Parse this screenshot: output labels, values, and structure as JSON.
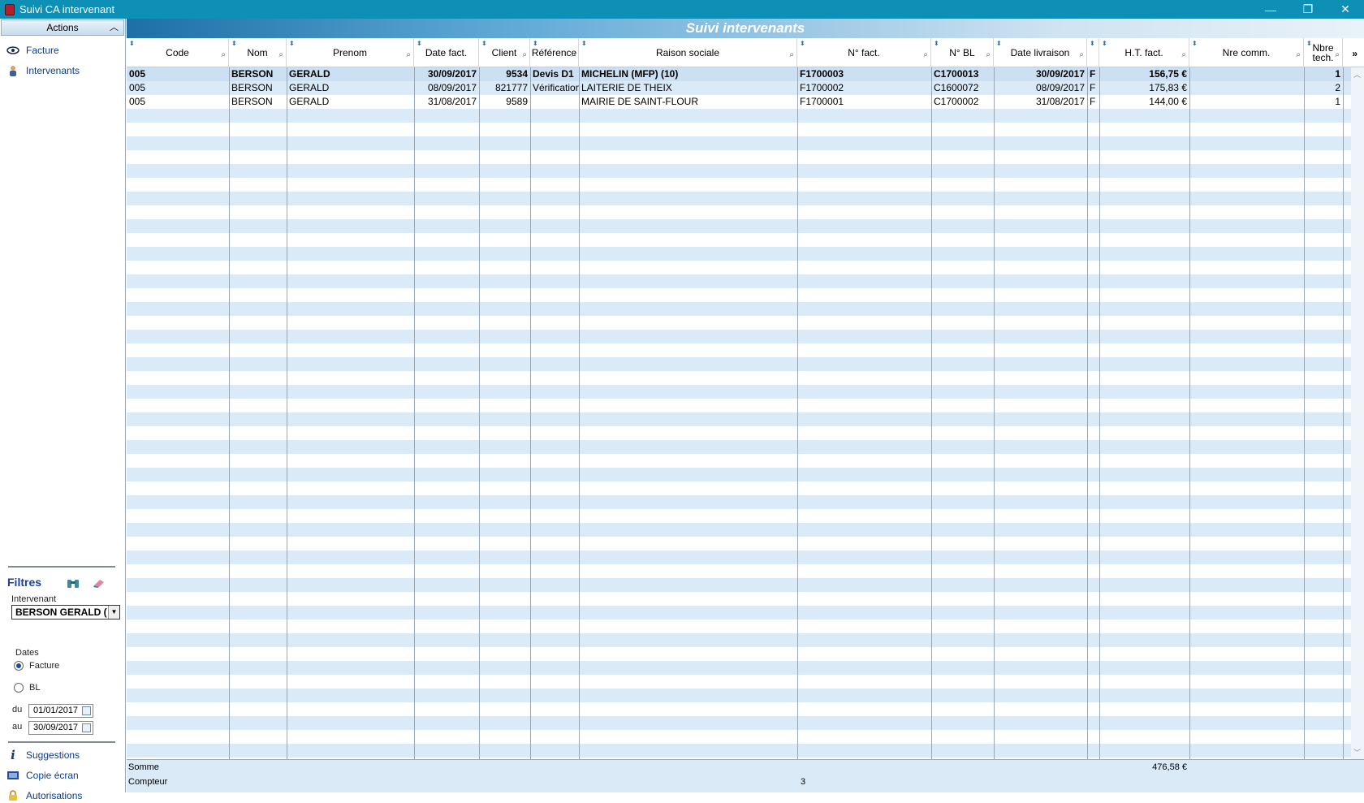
{
  "window": {
    "title": "Suivi CA intervenant",
    "controls": [
      "—",
      "❐",
      "✕"
    ]
  },
  "sidebar": {
    "actions_label": "Actions",
    "items": [
      {
        "label": "Facture",
        "icon": "eye-icon"
      },
      {
        "label": "Intervenants",
        "icon": "person-icon"
      }
    ]
  },
  "filters": {
    "title": "Filtres",
    "intervenant_label": "Intervenant",
    "intervenant_value": "BERSON GERALD (",
    "dates_label": "Dates",
    "radio_facture": "Facture",
    "radio_bl": "BL",
    "du_label": "du",
    "du_value": "01/01/2017",
    "au_label": "au",
    "au_value": "30/09/2017"
  },
  "bottom_links": [
    {
      "label": "Suggestions",
      "icon": "info-icon"
    },
    {
      "label": "Copie écran",
      "icon": "screenshot-icon"
    },
    {
      "label": "Autorisations",
      "icon": "lock-icon"
    }
  ],
  "banner_title": "Suivi intervenants",
  "table": {
    "columns": [
      "Code",
      "Nom",
      "Prenom",
      "Date fact.",
      "Client",
      "Référence",
      "Raison sociale",
      "N° fact.",
      "N° BL",
      "Date livraison",
      "",
      "H.T. fact.",
      "Nre comm.",
      "Nbre tech."
    ],
    "more_label": "»",
    "rows": [
      [
        "005",
        "BERSON",
        "GERALD",
        "30/09/2017",
        "9534",
        "Devis D1",
        "MICHELIN (MFP)  (10)",
        "F1700003",
        "C1700013",
        "30/09/2017",
        "F",
        "156,75 €",
        "",
        "1"
      ],
      [
        "005",
        "BERSON",
        "GERALD",
        "08/09/2017",
        "821777",
        "Vérification",
        "LAITERIE DE THEIX",
        "F1700002",
        "C1600072",
        "08/09/2017",
        "F",
        "175,83 €",
        "",
        "2"
      ],
      [
        "005",
        "BERSON",
        "GERALD",
        "31/08/2017",
        "9589",
        "",
        "MAIRIE DE SAINT-FLOUR",
        "F1700001",
        "C1700002",
        "31/08/2017",
        "F",
        "144,00 €",
        "",
        "1"
      ]
    ]
  },
  "footer": {
    "somme_label": "Somme",
    "somme_value": "476,58 €",
    "compteur_label": "Compteur",
    "compteur_value": "3"
  },
  "colors": {
    "titlebar": "#0e8fb6",
    "stripe": "#dbeaf7",
    "selected_row": "#cce0f3",
    "link": "#0a3d8f"
  }
}
